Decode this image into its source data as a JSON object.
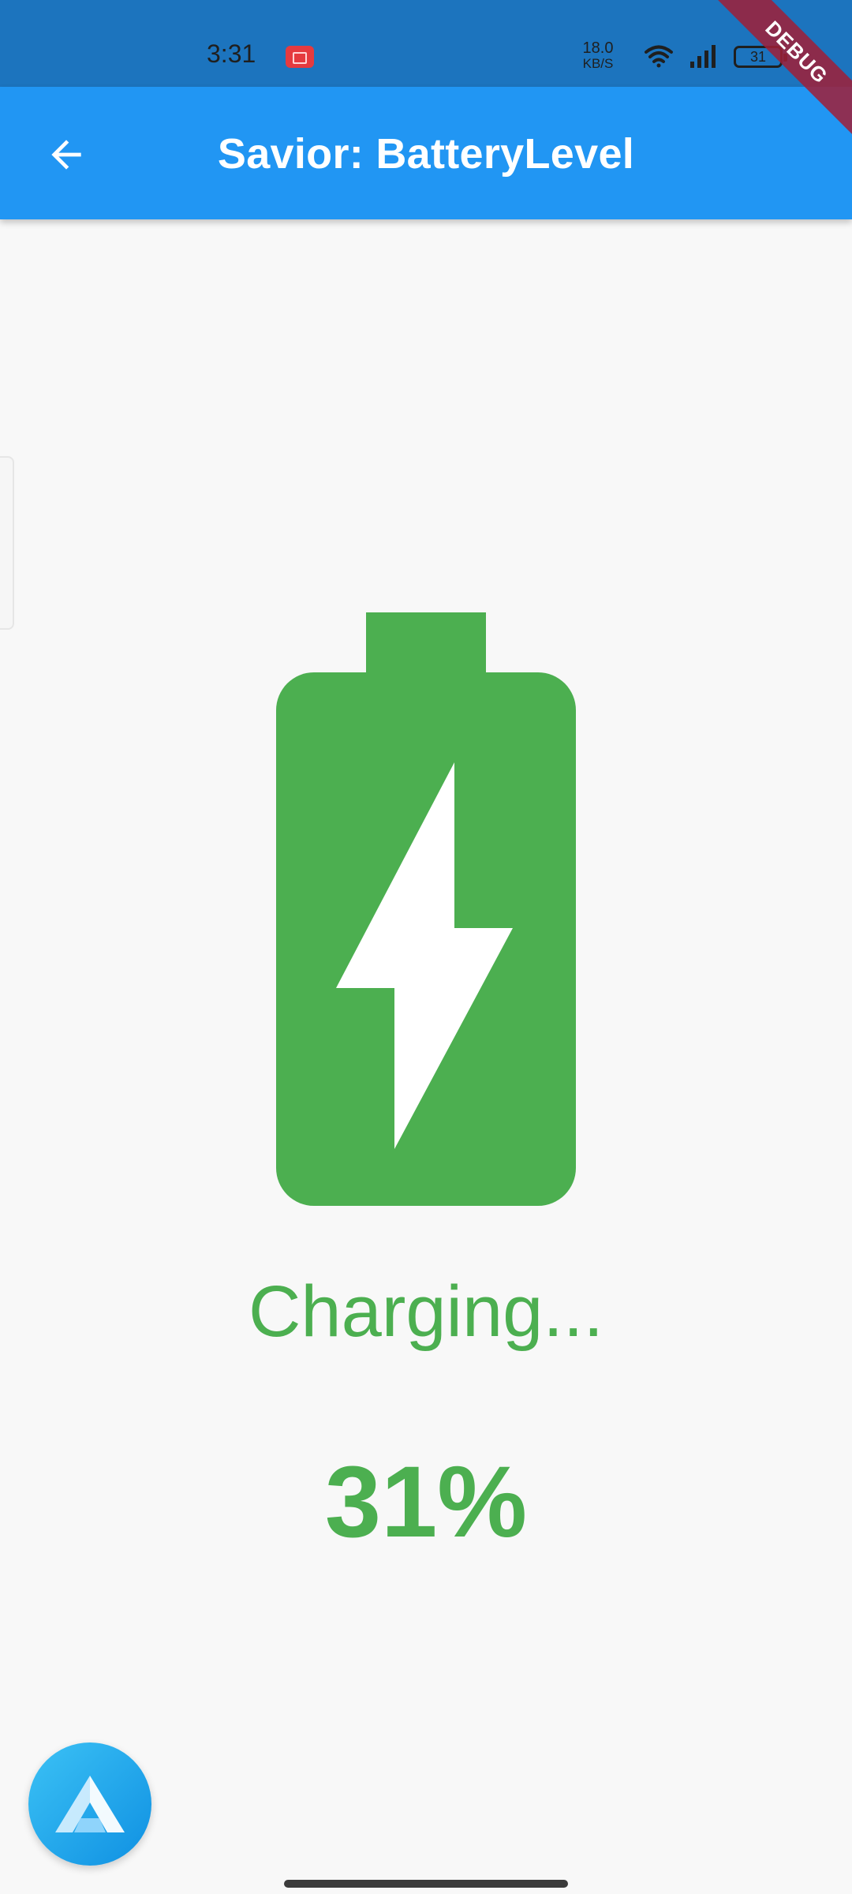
{
  "status_bar": {
    "time": "3:31",
    "net_speed_value": "18.0",
    "net_speed_unit": "KB/S",
    "battery_level": "31",
    "icons": [
      "screen-record-icon",
      "wifi-icon",
      "signal-icon",
      "battery-icon"
    ]
  },
  "app_bar": {
    "title": "Savior: BatteryLevel",
    "back_icon": "arrow-back-icon",
    "debug_banner": "DEBUG"
  },
  "battery": {
    "icon": "battery-charging-icon",
    "color": "#4caf50",
    "status_text": "Charging...",
    "percent_text": "31%"
  },
  "fab": {
    "icon": "app-logo-icon"
  },
  "colors": {
    "app_bar": "#2196f3",
    "status_bar": "#1c74be",
    "accent": "#4caf50",
    "background": "#f8f8f8"
  }
}
